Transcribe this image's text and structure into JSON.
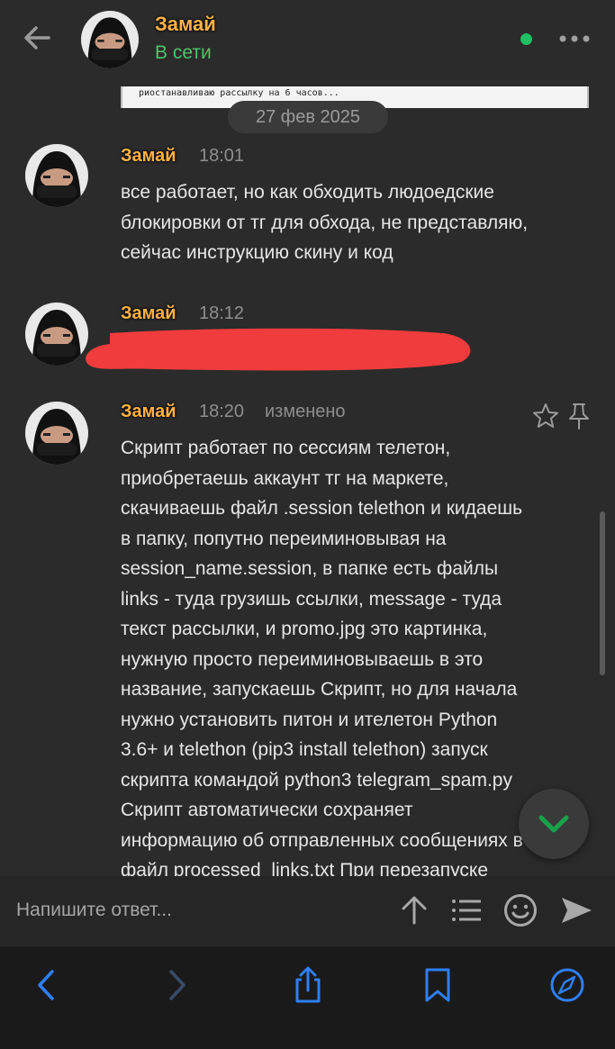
{
  "header": {
    "name": "Замай",
    "status": "В сети"
  },
  "preview_image_text": "риостанавливаю рассылку на 6 часов...",
  "date_divider": "27 фев 2025",
  "messages": [
    {
      "author": "Замай",
      "time": "18:01",
      "lines": [
        "все работает, но как обходить людоедские",
        "блокировки от тг для обхода, не представляю,",
        "сейчас инструкцию скину и код"
      ]
    },
    {
      "author": "Замай",
      "time": "18:12",
      "redacted": true
    },
    {
      "author": "Замай",
      "time": "18:20",
      "edited": "изменено",
      "lines": [
        "Скрипт работает по сессиям телетон,",
        "приобретаешь аккаунт тг на маркете,",
        "скачиваешь файл .session telethon и кидаешь",
        "в папку, попутно переиминовывая на",
        "session_name.session, в папке есть файлы",
        "links - туда грузишь ссылки, message - туда",
        "текст рассылки, и promo.jpg это картинка,",
        "нужную просто переиминовываешь в это",
        "название, запускаешь Скрипт, но для начала",
        "нужно установить питон и ителетон Python",
        "3.6+ и telethon (pip3 install telethon) запуск",
        "скрипта командой python3 telegram_spam.py",
        "Скрипт автоматически сохраняет",
        "информацию об отправленных сообщениях в",
        "файл processed_links.txt При перезапуске"
      ]
    }
  ],
  "composer": {
    "placeholder": "Напишите ответ..."
  },
  "icons": {
    "header": [
      "back-arrow-icon",
      "more-icon"
    ],
    "message_actions": [
      "star-icon",
      "pin-icon"
    ],
    "composer": [
      "arrow-up-icon",
      "list-icon",
      "smiley-icon",
      "send-icon"
    ],
    "browser": [
      "back-icon",
      "forward-icon",
      "share-icon",
      "bookmark-icon",
      "compass-icon"
    ]
  },
  "colors": {
    "background": "#2b2b2b",
    "author_name": "#ffb347",
    "online": "#1fbf63",
    "browser_accent": "#2f7ff5",
    "fab_check": "#17a34a",
    "redaction": "#f03c3c"
  }
}
